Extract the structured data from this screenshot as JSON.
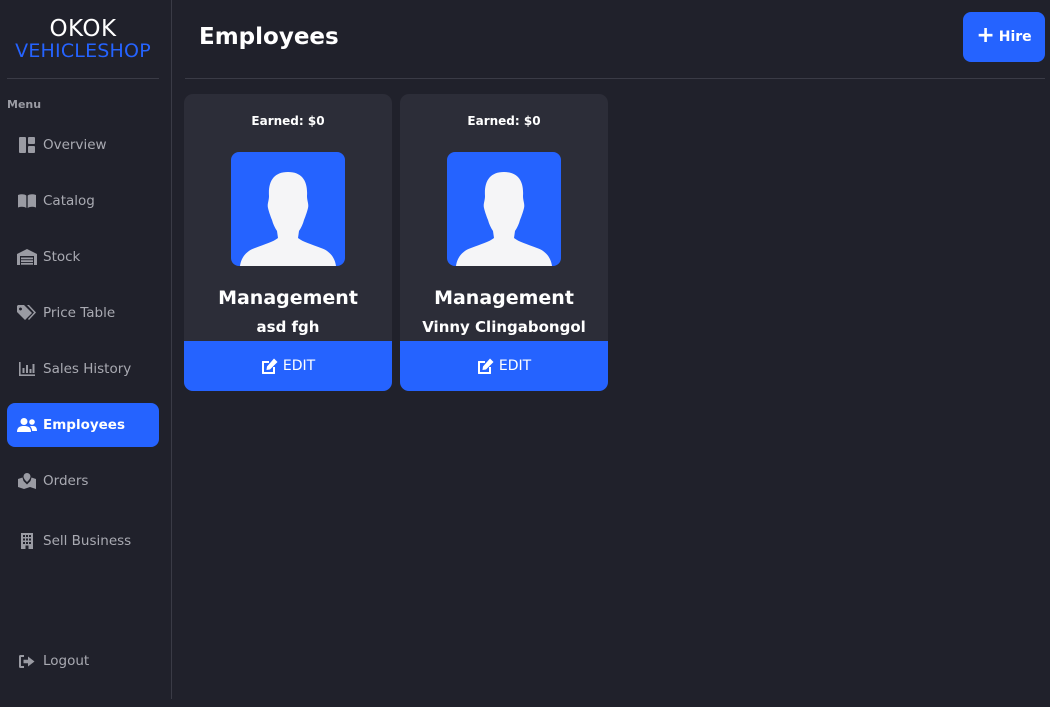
{
  "brand": {
    "line1": "OKOK",
    "line2": "VEHICLESHOP"
  },
  "colors": {
    "accent": "#2563ff",
    "background": "#20212b",
    "card": "#2c2d38"
  },
  "sidebar": {
    "menu_label": "Menu",
    "items": [
      {
        "label": "Overview",
        "icon": "dashboard-icon"
      },
      {
        "label": "Catalog",
        "icon": "book-icon"
      },
      {
        "label": "Stock",
        "icon": "warehouse-icon"
      },
      {
        "label": "Price Table",
        "icon": "tags-icon"
      },
      {
        "label": "Sales History",
        "icon": "chart-icon"
      },
      {
        "label": "Employees",
        "icon": "users-icon",
        "active": true
      },
      {
        "label": "Orders",
        "icon": "map-icon"
      },
      {
        "label": "Sell Business",
        "icon": "building-icon"
      }
    ],
    "logout_label": "Logout"
  },
  "header": {
    "title": "Employees",
    "hire_label": "Hire"
  },
  "employees": [
    {
      "earned": "Earned: $0",
      "role": "Management",
      "name": "asd fgh",
      "edit_label": "EDIT"
    },
    {
      "earned": "Earned: $0",
      "role": "Management",
      "name": "Vinny Clingabongol",
      "edit_label": "EDIT"
    }
  ]
}
